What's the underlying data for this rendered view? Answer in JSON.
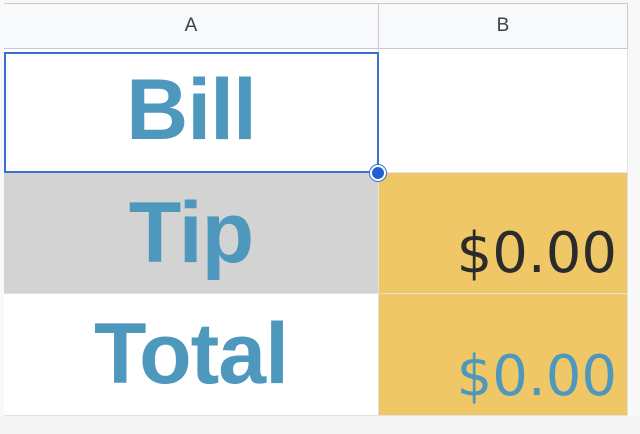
{
  "columns": [
    {
      "letter": "A"
    },
    {
      "letter": "B"
    }
  ],
  "rows": [
    {
      "label": "Bill",
      "value": ""
    },
    {
      "label": "Tip",
      "value": "$0.00"
    },
    {
      "label": "Total",
      "value": "$0.00"
    }
  ],
  "selection": {
    "cell": "A1"
  },
  "colors": {
    "label_text": "#4e97bd",
    "tip_label_fill": "#d3d3d3",
    "value_fill": "#f0c766",
    "tip_value_text": "#2b2b2b",
    "total_value_text": "#4e97bd",
    "selection_border": "#3b6fd6"
  }
}
